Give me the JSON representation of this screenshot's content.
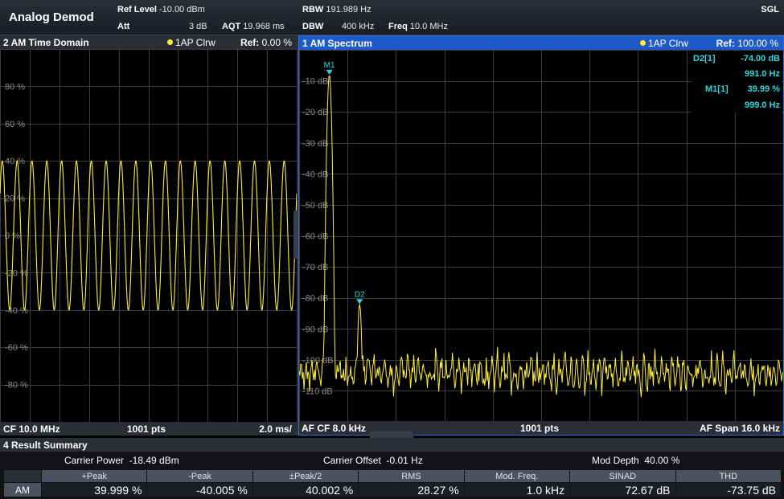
{
  "app": {
    "title": "Analog Demod",
    "mode": "SGL"
  },
  "status": {
    "ref_level_label": "Ref Level",
    "ref_level_value": "-10.00 dBm",
    "att_label": "Att",
    "att_value": "3 dB",
    "aqt_label": "AQT",
    "aqt_value": "19.968 ms",
    "rbw_label": "RBW",
    "rbw_value": "191.989 Hz",
    "dbw_label": "DBW",
    "dbw_value": "400 kHz",
    "freq_label": "Freq",
    "freq_value": "10.0 MHz"
  },
  "time_domain": {
    "title": "2 AM Time Domain",
    "trace": "1AP Clrw",
    "ref_label": "Ref:",
    "ref_value": "0.00 %",
    "y_ticks": [
      "80 %",
      "60 %",
      "40 %",
      "20 %",
      "0 %",
      "-20 %",
      "-40 %",
      "-60 %",
      "-80 %"
    ],
    "footer_left": "CF 10.0 MHz",
    "footer_center": "1001 pts",
    "footer_right": "2.0 ms/",
    "chart_data": {
      "type": "line",
      "x_unit": "ms",
      "x_range": [
        0,
        20
      ],
      "y_range": [
        -100,
        100
      ],
      "amplitude_percent": 40,
      "signal_frequency_khz": 1.0,
      "periods_shown": 20,
      "color": "#ffef3a"
    }
  },
  "spectrum": {
    "title": "1 AM Spectrum",
    "trace": "1AP Clrw",
    "ref_label": "Ref:",
    "ref_value": "100.00 %",
    "y_ticks": [
      "-10 dB",
      "-20 dB",
      "-30 dB",
      "-40 dB",
      "-50 dB",
      "-60 dB",
      "-70 dB",
      "-80 dB",
      "-90 dB",
      "-100 dB",
      "-110 dB"
    ],
    "footer_left": "AF CF 8.0 kHz",
    "footer_center": "1001 pts",
    "footer_right": "AF Span 16.0 kHz",
    "markers": [
      {
        "label": "M1",
        "table_name": "M1[1]",
        "value": "39.99 %",
        "freq": "999.0 Hz",
        "x_khz": 1.0,
        "y_db": -8
      },
      {
        "label": "D2",
        "table_name": "D2[1]",
        "value": "-74.00 dB",
        "freq": "991.0 Hz",
        "x_khz": 2.0,
        "y_db": -82
      }
    ],
    "chart_data": {
      "type": "line",
      "x_unit": "kHz",
      "x_range": [
        0,
        16
      ],
      "y_range": [
        -120,
        0
      ],
      "peaks": [
        {
          "x": 1.0,
          "y": -8
        },
        {
          "x": 2.0,
          "y": -82
        }
      ],
      "noise_floor_db": [
        -110,
        -98
      ],
      "color": "#ffef3a"
    }
  },
  "results": {
    "title": "4 Result Summary",
    "carrier_power_label": "Carrier Power",
    "carrier_power_value": "-18.49 dBm",
    "carrier_offset_label": "Carrier Offset",
    "carrier_offset_value": "-0.01 Hz",
    "mod_depth_label": "Mod Depth",
    "mod_depth_value": "40.00 %",
    "columns": [
      "+Peak",
      "-Peak",
      "±Peak/2",
      "RMS",
      "Mod. Freq.",
      "SINAD",
      "THD"
    ],
    "row_label": "AM",
    "values": [
      "39.999 %",
      "-40.005 %",
      "40.002 %",
      "28.27 %",
      "1.0 kHz",
      "72.67 dB",
      "-73.75 dB"
    ]
  }
}
